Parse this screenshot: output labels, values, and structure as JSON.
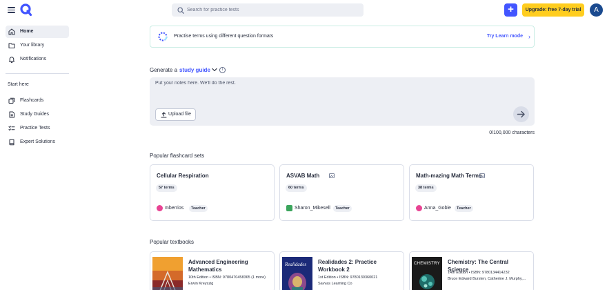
{
  "search": {
    "placeholder": "Search for practice tests"
  },
  "header": {
    "create_label": "+",
    "upgrade_label": "Upgrade: free 7-day trial",
    "avatar_initial": "A"
  },
  "sidebar": {
    "items": [
      {
        "label": "Home",
        "icon": "home-icon",
        "active": true
      },
      {
        "label": "Your library",
        "icon": "folder-icon"
      },
      {
        "label": "Notifications",
        "icon": "bell-icon"
      }
    ],
    "start_here_label": "Start here",
    "start_items": [
      {
        "label": "Flashcards",
        "icon": "flashcards-icon"
      },
      {
        "label": "Study Guides",
        "icon": "study-guides-icon"
      },
      {
        "label": "Practice Tests",
        "icon": "practice-tests-icon"
      },
      {
        "label": "Expert Solutions",
        "icon": "book-icon"
      }
    ]
  },
  "learn_banner": {
    "text": "Practise terms using different question formats",
    "link": "Try Learn mode",
    "chevron": "›"
  },
  "generate": {
    "label": "Generate a",
    "type": "study guide",
    "info": "i",
    "notes_placeholder": "Put your notes here. We'll do the rest.",
    "upload_label": "Upload file",
    "char_count": "0/100,000 characters"
  },
  "flashcards": {
    "title": "Popular flashcard sets",
    "sets": [
      {
        "title": "Cellular Respiration",
        "terms": "57 terms",
        "user": "mberrios",
        "role": "Teacher",
        "avatar_color": "#e84393",
        "has_badge": false
      },
      {
        "title": "ASVAB Math",
        "terms": "60 terms",
        "user": "Sharon_Mikesell",
        "role": "Teacher",
        "avatar_color": "#3ba55c",
        "has_badge": true
      },
      {
        "title": "Math-mazing Math Terms",
        "terms": "38 terms",
        "user": "Anna_Goble",
        "role": "Teacher",
        "avatar_color": "#e84393",
        "has_badge": true
      }
    ]
  },
  "textbooks": {
    "title": "Popular textbooks",
    "books": [
      {
        "title": "Advanced Engineering Mathematics",
        "edition": "10th Edition • ISBN: 9780470458365 (1 more)",
        "author": "Erwin Kreyszig"
      },
      {
        "title": "Realidades 2: Practice Workbook 2",
        "edition": "1st Edition • ISBN: 9780130360021",
        "author": "Savvas Learning Co"
      },
      {
        "title": "Chemistry: The Central Science",
        "edition": "14th Edition • ISBN: 9780134414232",
        "author": "Bruce Edward Bursten, Catherine J. Murphy,..."
      }
    ],
    "cover_texts": [
      "Realidades",
      "CHEMISTRY"
    ]
  }
}
